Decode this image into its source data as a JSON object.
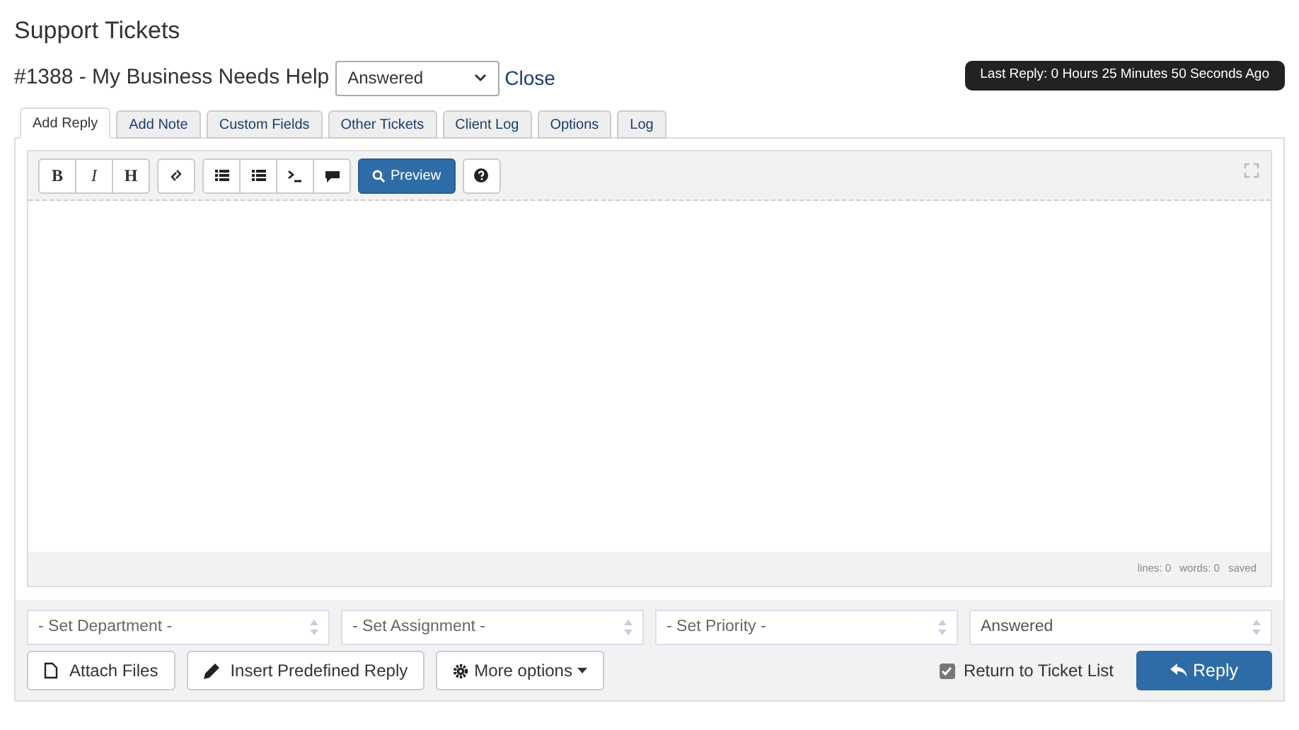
{
  "page_title": "Support Tickets",
  "ticket": {
    "title": "#1388 - My Business Needs Help",
    "status_select": "Answered",
    "close_link": "Close",
    "last_reply": "Last Reply: 0 Hours 25 Minutes 50 Seconds Ago"
  },
  "tabs": [
    {
      "label": "Add Reply",
      "selected": true
    },
    {
      "label": "Add Note",
      "selected": false
    },
    {
      "label": "Custom Fields",
      "selected": false
    },
    {
      "label": "Other Tickets",
      "selected": false
    },
    {
      "label": "Client Log",
      "selected": false
    },
    {
      "label": "Options",
      "selected": false
    },
    {
      "label": "Log",
      "selected": false
    }
  ],
  "toolbar": [
    [
      {
        "kind": "text",
        "label": "B"
      },
      {
        "kind": "text",
        "label": "I"
      },
      {
        "kind": "text",
        "label": "H"
      }
    ],
    [
      {
        "kind": "link"
      }
    ],
    [
      {
        "kind": "list"
      },
      {
        "kind": "list"
      },
      {
        "kind": "code"
      },
      {
        "kind": "quote"
      }
    ],
    [
      {
        "kind": "preview",
        "label": "Preview"
      }
    ],
    [
      {
        "kind": "help"
      }
    ]
  ],
  "editor_status": {
    "lines": "lines: 0",
    "words": "words: 0",
    "saved": "saved"
  },
  "selects": [
    {
      "placeholder": "- Set Department -"
    },
    {
      "placeholder": "- Set Assignment -"
    },
    {
      "placeholder": "- Set Priority -"
    },
    {
      "value": "Answered"
    }
  ],
  "buttons": [
    {
      "kind": "attach",
      "label": "Attach Files"
    },
    {
      "kind": "predefined",
      "label": "Insert Predefined Reply"
    },
    {
      "kind": "more",
      "label": "More options"
    }
  ],
  "return_to_list": {
    "label": "Return to Ticket List",
    "checked": true
  },
  "reply_button": "Reply"
}
